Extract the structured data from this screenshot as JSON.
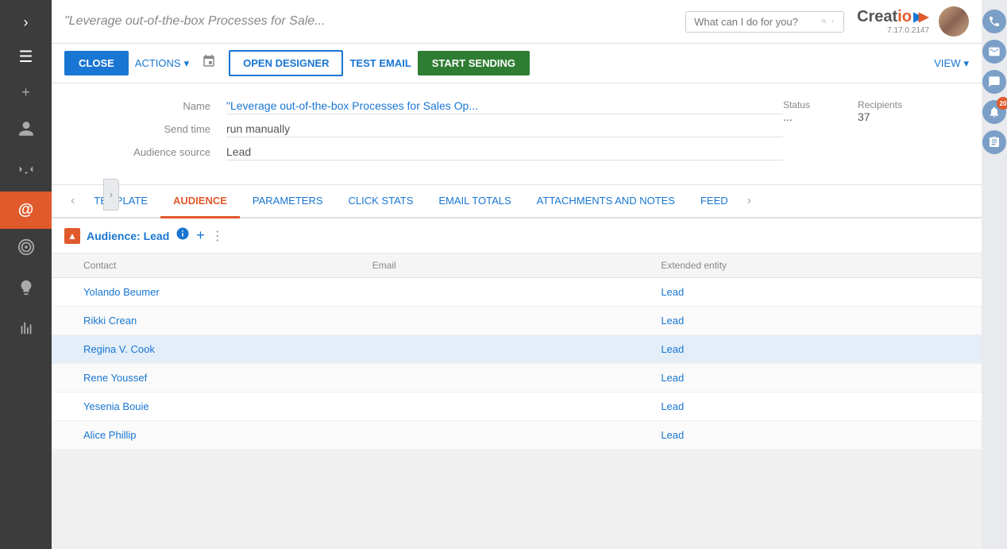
{
  "sidebar": {
    "icons": [
      {
        "name": "arrow-right-icon",
        "symbol": "›",
        "active": false
      },
      {
        "name": "menu-icon",
        "symbol": "☰",
        "active": false
      },
      {
        "name": "plus-icon",
        "symbol": "+",
        "active": false
      },
      {
        "name": "person-icon",
        "symbol": "👤",
        "active": false
      },
      {
        "name": "megaphone-icon",
        "symbol": "📣",
        "active": false
      },
      {
        "name": "email-icon",
        "symbol": "@",
        "active": true
      },
      {
        "name": "target-icon",
        "symbol": "🎯",
        "active": false
      },
      {
        "name": "lightbulb-icon",
        "symbol": "💡",
        "active": false
      },
      {
        "name": "chart-icon",
        "symbol": "📊",
        "active": false
      }
    ]
  },
  "topbar": {
    "title": "\"Leverage out-of-the-box Processes for Sale...",
    "search_placeholder": "What can I do for you?",
    "logo": "Creatio",
    "version": "7.17.0.2147"
  },
  "actionbar": {
    "close_label": "CLOSE",
    "actions_label": "ACTIONS",
    "open_designer_label": "OPEN DESIGNER",
    "test_email_label": "TEST EMAIL",
    "start_sending_label": "START SENDING",
    "view_label": "VIEW"
  },
  "info": {
    "name_label": "Name",
    "name_value": "\"Leverage out-of-the-box Processes for Sales Op...",
    "send_time_label": "Send time",
    "send_time_value": "run manually",
    "audience_source_label": "Audience source",
    "audience_source_value": "Lead",
    "status_label": "Status",
    "status_value": "...",
    "recipients_label": "Recipients",
    "recipients_value": "37"
  },
  "tabs": {
    "prev_label": "‹",
    "next_label": "›",
    "items": [
      {
        "label": "TEMPLATE",
        "active": false
      },
      {
        "label": "AUDIENCE",
        "active": true
      },
      {
        "label": "PARAMETERS",
        "active": false
      },
      {
        "label": "CLICK STATS",
        "active": false
      },
      {
        "label": "EMAIL TOTALS",
        "active": false
      },
      {
        "label": "ATTACHMENTS AND NOTES",
        "active": false
      },
      {
        "label": "FEED",
        "active": false
      }
    ]
  },
  "audience": {
    "title": "Audience: Lead",
    "collapse_icon": "▲",
    "columns": [
      "Contact",
      "Email",
      "Extended entity"
    ],
    "rows": [
      {
        "contact": "Yolando Beumer",
        "email": "",
        "entity": "Lead",
        "selected": false
      },
      {
        "contact": "Rikki Crean",
        "email": "",
        "entity": "Lead",
        "selected": false
      },
      {
        "contact": "Regina V. Cook",
        "email": "",
        "entity": "Lead",
        "selected": true
      },
      {
        "contact": "Rene Youssef",
        "email": "",
        "entity": "Lead",
        "selected": false
      },
      {
        "contact": "Yesenia Bouie",
        "email": "",
        "entity": "Lead",
        "selected": false
      },
      {
        "contact": "Alice Phillip",
        "email": "",
        "entity": "Lead",
        "selected": false
      }
    ]
  },
  "right_panel": {
    "icons": [
      {
        "name": "phone-icon",
        "symbol": "📞"
      },
      {
        "name": "mail-icon",
        "symbol": "✉"
      },
      {
        "name": "chat-icon",
        "symbol": "💬"
      },
      {
        "name": "bell-icon",
        "symbol": "🔔",
        "badge": "20"
      },
      {
        "name": "clipboard-icon",
        "symbol": "📋"
      }
    ]
  }
}
